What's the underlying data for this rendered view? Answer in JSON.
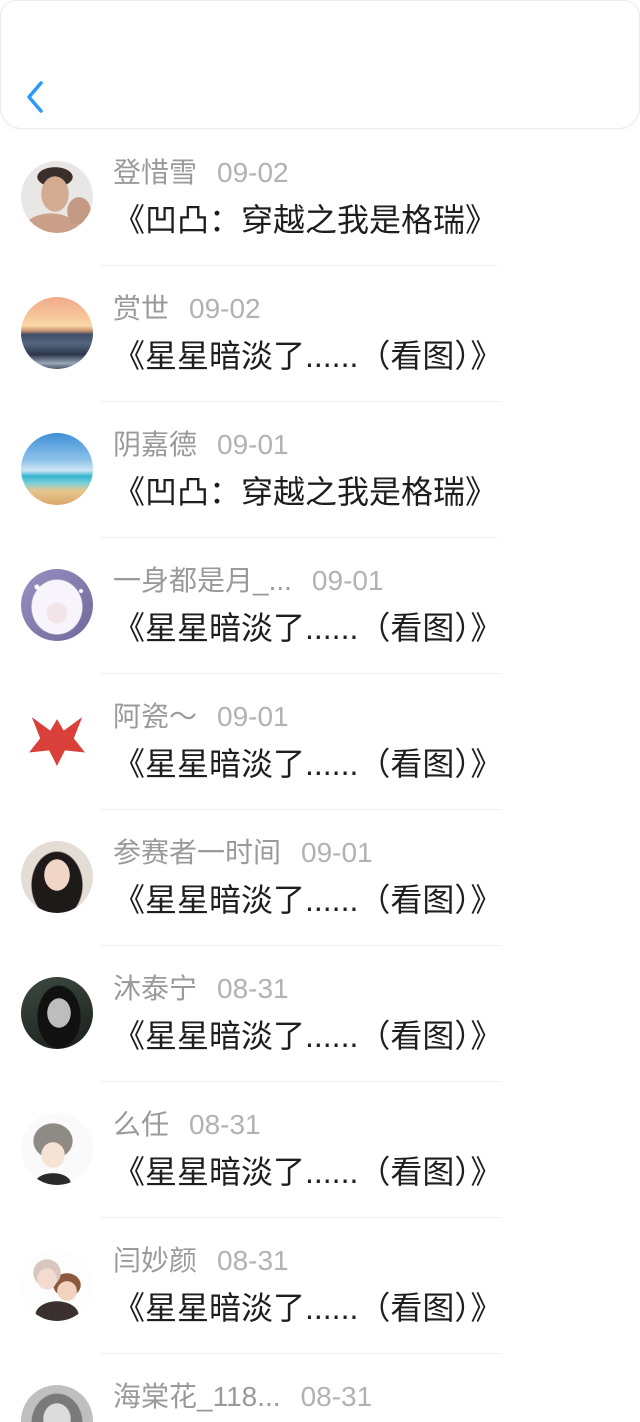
{
  "header": {
    "back_icon": "chevron-left-icon"
  },
  "colors": {
    "accent": "#2b9af3",
    "name_text": "#9a9a9a",
    "date_text": "#b2b2b2",
    "title_text": "#1e1e1e",
    "divider": "#f0f0f0"
  },
  "list": {
    "items": [
      {
        "name": "登惜雪",
        "date": "09-02",
        "title": "《凹凸：穿越之我是格瑞》"
      },
      {
        "name": "赏世",
        "date": "09-02",
        "title": "《星星暗淡了......（看图）》"
      },
      {
        "name": "阴嘉德",
        "date": "09-01",
        "title": "《凹凸：穿越之我是格瑞》"
      },
      {
        "name": "一身都是月_...",
        "date": "09-01",
        "title": "《星星暗淡了......（看图）》"
      },
      {
        "name": "阿瓷～",
        "date": "09-01",
        "title": "《星星暗淡了......（看图）》"
      },
      {
        "name": "参赛者一时间",
        "date": "09-01",
        "title": "《星星暗淡了......（看图）》"
      },
      {
        "name": "沐泰宁",
        "date": "08-31",
        "title": "《星星暗淡了......（看图）》"
      },
      {
        "name": "么任",
        "date": "08-31",
        "title": "《星星暗淡了......（看图）》"
      },
      {
        "name": "闫妙颜",
        "date": "08-31",
        "title": "《星星暗淡了......（看图）》"
      },
      {
        "name": "海棠花_118...",
        "date": "08-31"
      }
    ]
  }
}
